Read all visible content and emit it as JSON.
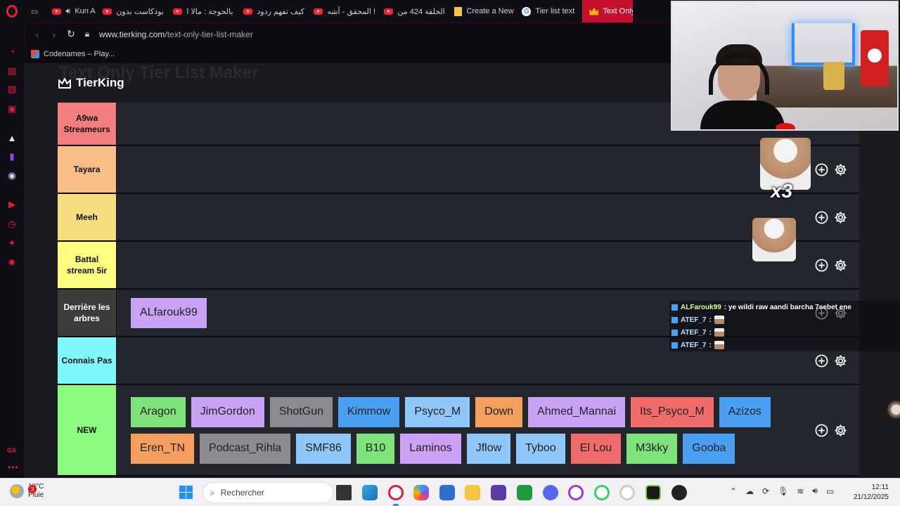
{
  "browser": {
    "tabs": [
      {
        "label": "Kun Anta",
        "icon": "youtube",
        "audio": true
      },
      {
        "label": "بودكاست بدون",
        "icon": "youtube"
      },
      {
        "label": "بالحوجة : مالا ا",
        "icon": "youtube"
      },
      {
        "label": "كيف تفهم ردود",
        "icon": "youtube"
      },
      {
        "label": "المحقق - أشه !",
        "icon": "youtube"
      },
      {
        "label": "الحلقة 424 من",
        "icon": "youtube"
      },
      {
        "label": "Create a New",
        "icon": "doc"
      },
      {
        "label": "Tier list text",
        "icon": "google"
      },
      {
        "label": "Text Only",
        "icon": "crown",
        "active": true
      }
    ],
    "url_domain": "www.tierking.com",
    "url_path": "/text-only-tier-list-maker",
    "bookmark": "Codenames – Play..."
  },
  "page": {
    "ghost_title": "Text Only Tier List Maker",
    "brand": "TierKing"
  },
  "tiers": [
    {
      "label": "A9wa Streameurs",
      "color": "#f27e7e",
      "items": []
    },
    {
      "label": "Tayara",
      "color": "#f7be88",
      "items": []
    },
    {
      "label": "Meeh",
      "color": "#f8dd7f",
      "items": []
    },
    {
      "label": "Battal stream 5ir",
      "color": "#fdfd80",
      "items": []
    },
    {
      "label": "Derrière les arbres",
      "color": "#3c3c3c",
      "text_color": "#ffffff",
      "items": [
        {
          "name": "ALfarouk99",
          "color": "#caa2f5"
        }
      ]
    },
    {
      "label": "Connais Pas",
      "color": "#7ff8fc",
      "items": []
    },
    {
      "label": "NEW",
      "color": "#8bfb7f",
      "items": [
        {
          "name": "Aragon",
          "color": "#7fe27a"
        },
        {
          "name": "JimGordon",
          "color": "#caa2f5"
        },
        {
          "name": "ShotGun",
          "color": "#8c8c90"
        },
        {
          "name": "Kimmow",
          "color": "#4a9ff0"
        },
        {
          "name": "Psyco_M",
          "color": "#8fc8f8"
        },
        {
          "name": "Down",
          "color": "#f49f5d"
        },
        {
          "name": "Ahmed_Mannai",
          "color": "#caa2f5"
        },
        {
          "name": "Its_Psyco_M",
          "color": "#ef6b6b"
        },
        {
          "name": "Azizos",
          "color": "#4a9ff0"
        },
        {
          "name": "Eren_TN",
          "color": "#f49f5d"
        },
        {
          "name": "Podcast_Rihla",
          "color": "#8c8c90"
        },
        {
          "name": "SMF86",
          "color": "#8fc8f8"
        },
        {
          "name": "B10",
          "color": "#7fe27a"
        },
        {
          "name": "Laminos",
          "color": "#caa2f5"
        },
        {
          "name": "Jflow",
          "color": "#8fc8f8"
        },
        {
          "name": "Tyboo",
          "color": "#8fc8f8"
        },
        {
          "name": "El Lou",
          "color": "#ef6b6b"
        },
        {
          "name": "M3kky",
          "color": "#7fe27a"
        },
        {
          "name": "Gooba",
          "color": "#4a9ff0"
        }
      ]
    }
  ],
  "overlay": {
    "emote_multiplier": "x3",
    "chat": [
      {
        "user": "ALFarouk99",
        "message": ": ye wildi raw aandi barcha 7sebet ene"
      },
      {
        "user": "ATEF_7",
        "message": ":"
      },
      {
        "user": "ATEF_7",
        "message": ":"
      },
      {
        "user": "ATEF_7",
        "message": ":"
      }
    ]
  },
  "taskbar": {
    "weather_temp": "10°C",
    "weather_desc": "Pluie",
    "weather_badge": "3",
    "search_placeholder": "Rechercher",
    "time": "12:11",
    "date": "21/12/2025"
  },
  "sidebar": {
    "gx_label": "GX"
  }
}
